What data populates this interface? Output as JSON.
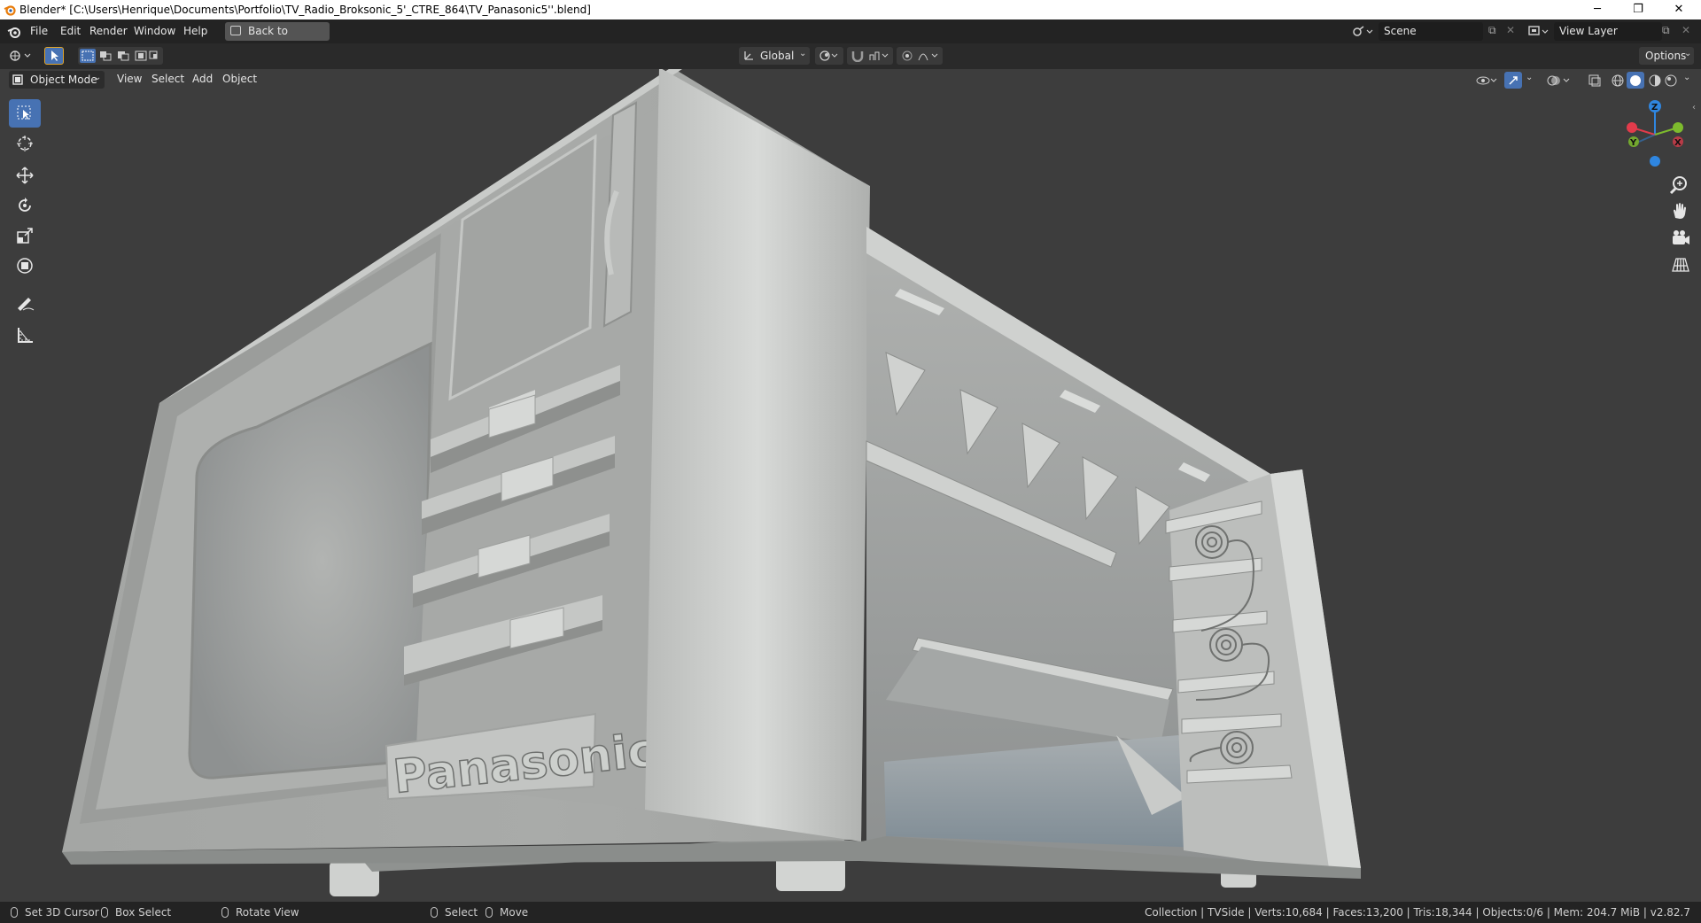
{
  "window": {
    "title": "Blender* [C:\\Users\\Henrique\\Documents\\Portfolio\\TV_Radio_Broksonic_5'_CTRE_864\\TV_Panasonic5''.blend]"
  },
  "topbar": {
    "menus": [
      "File",
      "Edit",
      "Render",
      "Window",
      "Help"
    ],
    "back_button": "Back to Previous",
    "scene": "Scene",
    "view_layer": "View Layer"
  },
  "header": {
    "orientation": "Global",
    "options": "Options"
  },
  "viewport_header": {
    "mode": "Object Mode",
    "menus": [
      "View",
      "Select",
      "Add",
      "Object"
    ]
  },
  "gizmo": {
    "x": "X",
    "y": "Y",
    "z": "Z"
  },
  "model": {
    "brand_text": "Panasonic"
  },
  "statusbar": {
    "left_click": "Set 3D Cursor",
    "box_select": "Box Select",
    "rotate": "Rotate View",
    "select": "Select",
    "move": "Move",
    "stats": "Collection | TVSide | Verts:10,684 | Faces:13,200 | Tris:18,344 | Objects:0/6 | Mem: 204.7 MiB | v2.82.7"
  },
  "colors": {
    "accent": "#4772b3",
    "axis_x": "#e23b4b",
    "axis_y": "#7dbb2d",
    "axis_z": "#2f86e0"
  }
}
